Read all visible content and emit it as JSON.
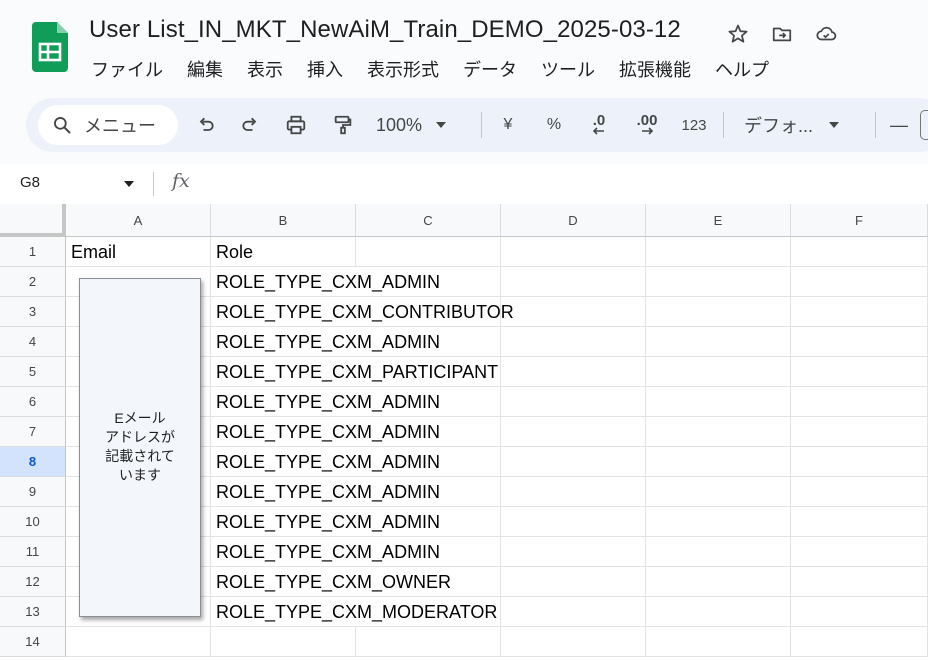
{
  "document": {
    "title": "User List_IN_MKT_NewAiM_Train_DEMO_2025-03-12"
  },
  "menu": [
    "ファイル",
    "編集",
    "表示",
    "挿入",
    "表示形式",
    "データ",
    "ツール",
    "拡張機能",
    "ヘルプ"
  ],
  "toolbar": {
    "search_label": "メニュー",
    "zoom": "100%",
    "currency": "¥",
    "percent": "%",
    "decrease_decimal": ".0",
    "increase_decimal": ".00",
    "number_format": "123",
    "font": "デフォ...",
    "minus": "—"
  },
  "formula_bar": {
    "cell_ref": "G8",
    "fx": "fx"
  },
  "columns": [
    "A",
    "B",
    "C",
    "D",
    "E",
    "F"
  ],
  "rows": [
    "1",
    "2",
    "3",
    "4",
    "5",
    "6",
    "7",
    "8",
    "9",
    "10",
    "11",
    "12",
    "13",
    "14"
  ],
  "selected_row": "8",
  "cells": {
    "header_email": "Email",
    "header_role": "Role",
    "roles": [
      "ROLE_TYPE_CXM_ADMIN",
      "ROLE_TYPE_CXM_CONTRIBUTOR",
      "ROLE_TYPE_CXM_ADMIN",
      "ROLE_TYPE_CXM_PARTICIPANT",
      "ROLE_TYPE_CXM_ADMIN",
      "ROLE_TYPE_CXM_ADMIN",
      "ROLE_TYPE_CXM_ADMIN",
      "ROLE_TYPE_CXM_ADMIN",
      "ROLE_TYPE_CXM_ADMIN",
      "ROLE_TYPE_CXM_ADMIN",
      "ROLE_TYPE_CXM_OWNER",
      "ROLE_TYPE_CXM_MODERATOR"
    ]
  },
  "overlay_note": {
    "lines": [
      "Eメール",
      "アドレスが",
      "記載されて",
      "います"
    ]
  },
  "colors": {
    "sheets_green": "#0f9d58",
    "selected_row_bg": "#d3e3fd",
    "selected_row_text": "#0b57d0"
  }
}
